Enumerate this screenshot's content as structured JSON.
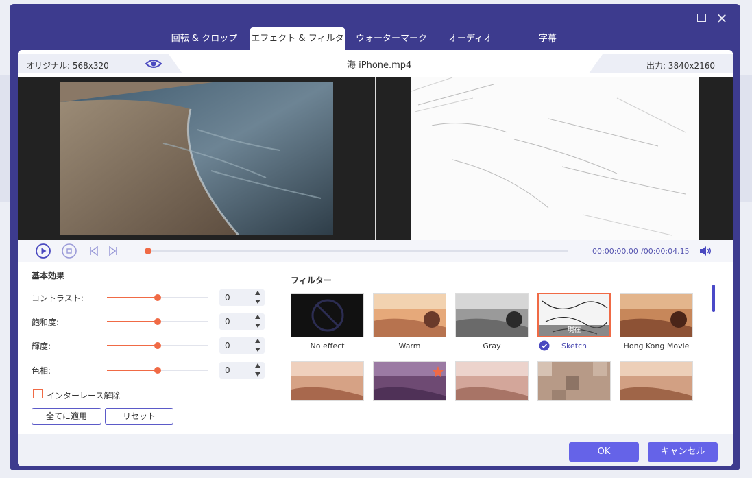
{
  "tabs": [
    {
      "label": "回転 & クロップ"
    },
    {
      "label": "エフェクト & フィルター"
    },
    {
      "label": "ウォーターマーク"
    },
    {
      "label": "オーディオ"
    },
    {
      "label": "字幕"
    }
  ],
  "active_tab_index": 1,
  "info": {
    "original": "オリジナル: 568x320",
    "file": "海  iPhone.mp4",
    "output": "出力: 3840x2160"
  },
  "player": {
    "time_current": "00:00:00.00",
    "time_total": "/00:00:04.15",
    "progress": 0.0
  },
  "adjust": {
    "title": "基本効果",
    "rows": [
      {
        "label": "コントラスト:",
        "value": "0",
        "level": 0.5
      },
      {
        "label": "飽和度:",
        "value": "0",
        "level": 0.5
      },
      {
        "label": "輝度:",
        "value": "0",
        "level": 0.5
      },
      {
        "label": "色相:",
        "value": "0",
        "level": 0.5
      }
    ],
    "deinterlace_label": "インターレース解除",
    "deinterlace_checked": false,
    "apply_all_label": "全てに適用",
    "reset_label": "リセット"
  },
  "filters": {
    "title": "フィルター",
    "items": [
      {
        "name": "No effect",
        "style": "none"
      },
      {
        "name": "Warm",
        "style": "warm"
      },
      {
        "name": "Gray",
        "style": "gray"
      },
      {
        "name": "Sketch",
        "style": "sketch",
        "selected": true,
        "tag": "現在"
      },
      {
        "name": "Hong Kong Movie",
        "style": "hk"
      },
      {
        "name": "",
        "style": "warm2"
      },
      {
        "name": "",
        "style": "purple",
        "star": true
      },
      {
        "name": "",
        "style": "pink"
      },
      {
        "name": "",
        "style": "mosaic"
      },
      {
        "name": "",
        "style": "warm3"
      }
    ]
  },
  "footer": {
    "ok_label": "OK",
    "cancel_label": "キャンセル"
  },
  "colors": {
    "frame": "#3d3b8e",
    "accent": "#f06a45",
    "primary": "#6563e8",
    "time_text": "#5554b0"
  }
}
